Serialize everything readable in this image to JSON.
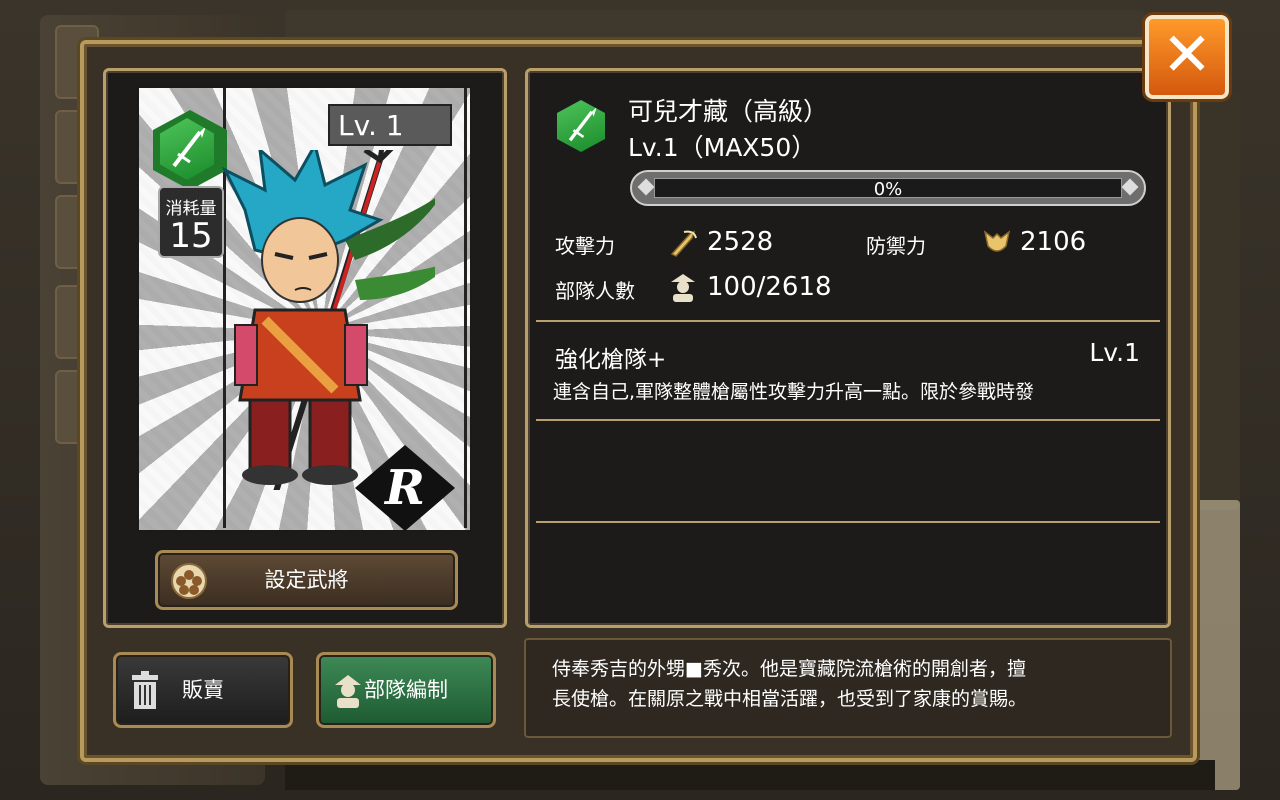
{
  "card": {
    "level_badge": "Lv. 1",
    "cost_label": "消耗量",
    "cost_value": "15",
    "rarity": "R"
  },
  "general": {
    "name": "可兒才藏（高級）",
    "level": "Lv.1（MAX50）",
    "exp_percent": 0,
    "exp_text": "0%"
  },
  "stats": {
    "attack_label": "攻擊力",
    "attack_value": "2528",
    "defense_label": "防禦力",
    "defense_value": "2106",
    "troops_label": "部隊人數",
    "troops_value": "100/2618"
  },
  "skill": {
    "name": "強化槍隊+",
    "level": "Lv.1",
    "description": "連含自己,軍隊整體槍屬性攻擊力升高一點。限於參戰時發"
  },
  "biography": {
    "line1": "侍奉秀吉的外甥■秀次。他是寶藏院流槍術的開創者，擅",
    "line2": "長使槍。在關原之戰中相當活躍，也受到了家康的賞賜。"
  },
  "buttons": {
    "set_general": "設定武將",
    "sell": "販賣",
    "team_edit": "部隊編制"
  },
  "colors": {
    "frame_gold": "#b9a06a",
    "attribute_green": "#2e9e3c",
    "close_orange": "#e8701a",
    "team_button_green": "#2f7a46"
  },
  "icons": {
    "attribute": "spear-attribute-icon",
    "attack": "feather-sword-icon",
    "defense": "armor-icon",
    "troops": "soldier-icon",
    "set": "sakura-crest-icon",
    "sell": "trash-icon",
    "team": "soldier-icon",
    "close": "close-icon"
  }
}
